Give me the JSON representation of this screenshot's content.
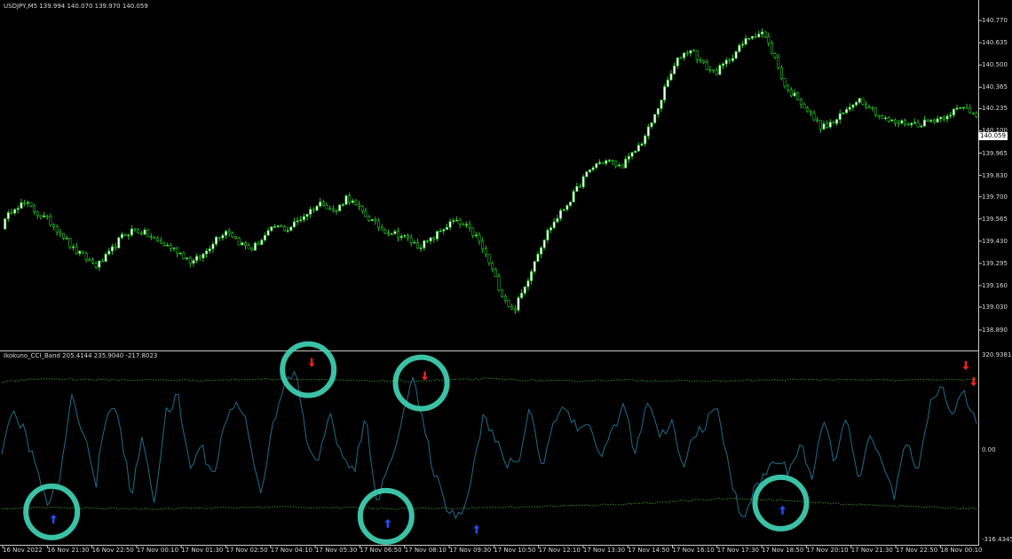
{
  "window": {
    "title": "USDJPY,M5  139.994 140.070 139.970 140.059"
  },
  "indicator": {
    "title": "Ikokuno_CCI_Band 205.4144 235.9040 -217.8023"
  },
  "colors": {
    "background": "#000000",
    "bull_candle": "#f0fff0",
    "bear_candle": "#26c826",
    "cci_line": "#1e6e8c",
    "band_line": "#3c8c2a",
    "arrow_up": "#1e50ff",
    "arrow_down": "#ff1e1e",
    "highlight_circle": "#40d2b4",
    "grid": "#3a3a3a"
  },
  "icons": {
    "signal_up": "arrow-up-icon",
    "signal_down": "arrow-down-icon"
  },
  "current_price_label": "140.059",
  "chart_data": [
    {
      "type": "line",
      "symbol": "USDJPY",
      "timeframe": "M5",
      "ylim": [
        138.82,
        140.83
      ],
      "y_ticks": [
        "140.770",
        "140.635",
        "140.500",
        "140.365",
        "140.235",
        "140.100",
        "139.965",
        "139.830",
        "139.700",
        "139.565",
        "139.430",
        "139.295",
        "139.160",
        "139.030",
        "138.890"
      ],
      "x_ticks": [
        "16 Nov 2022",
        "16 Nov 21:30",
        "16 Nov 22:50",
        "17 Nov 00:10",
        "17 Nov 01:30",
        "17 Nov 02:50",
        "17 Nov 04:10",
        "17 Nov 05:30",
        "17 Nov 06:50",
        "17 Nov 08:10",
        "17 Nov 09:30",
        "17 Nov 10:50",
        "17 Nov 12:10",
        "17 Nov 13:30",
        "17 Nov 14:50",
        "17 Nov 16:10",
        "17 Nov 17:30",
        "17 Nov 18:50",
        "17 Nov 20:10",
        "17 Nov 21:30",
        "17 Nov 22:50",
        "18 Nov 00:10"
      ],
      "close_path": [
        139.52,
        139.64,
        139.66,
        139.6,
        139.55,
        139.48,
        139.38,
        139.33,
        139.28,
        139.35,
        139.45,
        139.5,
        139.48,
        139.43,
        139.4,
        139.36,
        139.3,
        139.35,
        139.45,
        139.5,
        139.42,
        139.38,
        139.45,
        139.52,
        139.5,
        139.56,
        139.62,
        139.67,
        139.6,
        139.7,
        139.63,
        139.56,
        139.5,
        139.48,
        139.45,
        139.4,
        139.43,
        139.5,
        139.55,
        139.52,
        139.45,
        139.3,
        139.12,
        139.0,
        139.15,
        139.35,
        139.5,
        139.6,
        139.7,
        139.82,
        139.9,
        139.92,
        139.88,
        139.95,
        140.05,
        140.2,
        140.4,
        140.55,
        140.6,
        140.5,
        140.45,
        140.52,
        140.6,
        140.68,
        140.7,
        140.55,
        140.35,
        140.3,
        140.2,
        140.12,
        140.15,
        140.22,
        140.3,
        140.25,
        140.18,
        140.15,
        140.15,
        140.14,
        140.16,
        140.18,
        140.22,
        140.24,
        140.2
      ],
      "wick_amplitude": 0.025
    },
    {
      "type": "line",
      "name": "Ikokuno_CCI_Band",
      "ylim": [
        -316.4345,
        320.9381
      ],
      "y_ticks": [
        "320.9381",
        "0.00",
        "-316.4345"
      ],
      "upper_band": [
        230,
        240,
        238,
        236,
        236,
        235,
        238,
        240,
        236,
        233,
        232,
        236,
        240,
        235,
        232,
        236,
        234,
        232,
        233,
        236,
        238,
        236,
        235,
        238,
        236
      ],
      "lower_band": [
        -200,
        -196,
        -198,
        -200,
        -200,
        -198,
        -196,
        -194,
        -196,
        -198,
        -200,
        -198,
        -196,
        -194,
        -190,
        -186,
        -180,
        -172,
        -165,
        -170,
        -180,
        -186,
        -190,
        -196,
        -200
      ],
      "cci_path": [
        0,
        120,
        60,
        -80,
        -190,
        -90,
        180,
        60,
        -120,
        150,
        100,
        -160,
        40,
        -170,
        120,
        180,
        -60,
        10,
        -90,
        90,
        170,
        70,
        -150,
        60,
        210,
        270,
        20,
        -40,
        130,
        -40,
        -70,
        100,
        -180,
        -50,
        100,
        240,
        60,
        -100,
        -200,
        -230,
        -90,
        120,
        30,
        -50,
        -40,
        150,
        -60,
        90,
        160,
        60,
        100,
        -40,
        70,
        150,
        -20,
        170,
        30,
        100,
        -70,
        60,
        90,
        140,
        -90,
        -230,
        -150,
        -80,
        -30,
        -80,
        30,
        -100,
        90,
        -40,
        120,
        -110,
        50,
        -60,
        -160,
        30,
        -100,
        140,
        220,
        120,
        200,
        70
      ],
      "cci_noise": 45,
      "signals": [
        {
          "dir": "up",
          "t": 0.053,
          "v": -235
        },
        {
          "dir": "down",
          "t": 0.318,
          "v": 295
        },
        {
          "dir": "up",
          "t": 0.396,
          "v": -250
        },
        {
          "dir": "down",
          "t": 0.434,
          "v": 250
        },
        {
          "dir": "up",
          "t": 0.487,
          "v": -270
        },
        {
          "dir": "up",
          "t": 0.801,
          "v": -205
        },
        {
          "dir": "down",
          "t": 0.989,
          "v": 285
        },
        {
          "dir": "down",
          "t": 0.997,
          "v": 230
        }
      ],
      "highlighted_signals": [
        0,
        1,
        2,
        3,
        5
      ]
    }
  ]
}
